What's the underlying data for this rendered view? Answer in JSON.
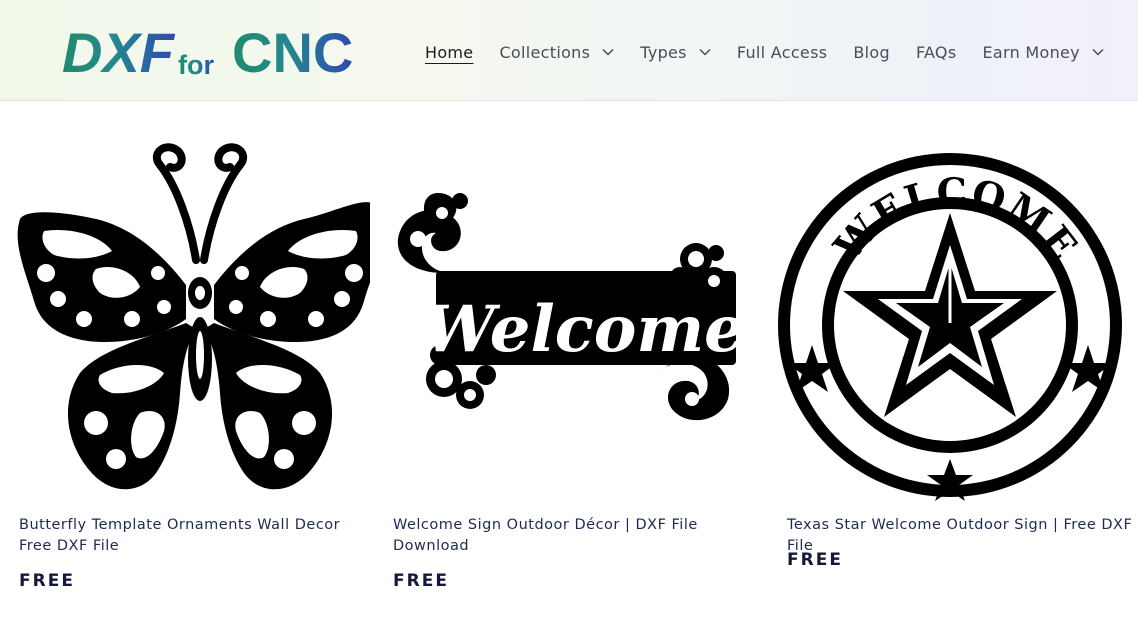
{
  "header": {
    "logo": {
      "part1": "DXF",
      "part2": "for",
      "part3": "CNC",
      "color_left": "#1f8a6e",
      "color_right": "#2e49b3"
    },
    "nav": [
      {
        "label": "Home",
        "active": true,
        "has_dropdown": false
      },
      {
        "label": "Collections",
        "active": false,
        "has_dropdown": true
      },
      {
        "label": "Types",
        "active": false,
        "has_dropdown": true
      },
      {
        "label": "Full Access",
        "active": false,
        "has_dropdown": false
      },
      {
        "label": "Blog",
        "active": false,
        "has_dropdown": false
      },
      {
        "label": "FAQs",
        "active": false,
        "has_dropdown": false
      },
      {
        "label": "Earn Money",
        "active": false,
        "has_dropdown": true
      }
    ]
  },
  "products": [
    {
      "title": "Butterfly Template Ornaments Wall Decor Free DXF File",
      "price": "FREE",
      "image": "butterfly-ornament"
    },
    {
      "title": "Welcome Sign Outdoor Décor | DXF File Download",
      "price": "FREE",
      "image": "welcome-sign",
      "image_text": "Welcome"
    },
    {
      "title": "Texas Star Welcome Outdoor Sign | Free DXF File",
      "price": "FREE",
      "image": "texas-star-sign",
      "image_text": "WELCOME"
    }
  ],
  "colors": {
    "title_text": "#1f2a52",
    "price_text": "#15173d",
    "nav_text": "#4a4d57"
  }
}
